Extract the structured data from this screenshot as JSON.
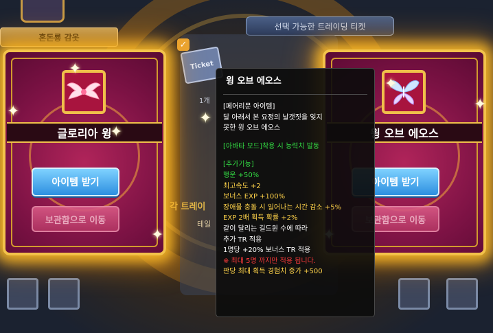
{
  "background": {
    "left_tab": "혼돈룡 감옷",
    "right_tab": "선택 가능한 트레이딩 티켓",
    "ticket_label": "Ticket",
    "ticket_qty": "1개",
    "info_heading": "각 트레이",
    "info_sub": "테일"
  },
  "cards": [
    {
      "name": "글로리아 윙",
      "get_button": "아이템 받기",
      "move_button": "보관함으로 이동",
      "icon": "gloria-wing-icon"
    },
    {
      "name": "윙 오브 에오스",
      "get_button": "아이템 받기",
      "move_button": "보관함으로 이동",
      "icon": "wing-of-eos-icon"
    }
  ],
  "tooltip": {
    "title": "윙 오브 에오스",
    "lines": [
      {
        "text": "[페어리문 아이템]",
        "color": "#ffffff"
      },
      {
        "text": "달 아래서 본 요정의 날갯짓을 잊지",
        "color": "#ffffff"
      },
      {
        "text": "못한 윙 오브 에오스",
        "color": "#ffffff"
      },
      {
        "text": "",
        "color": ""
      },
      {
        "text": "[아바타 모드]착용 시 능력치 발동",
        "color": "#33dd44"
      },
      {
        "text": "",
        "color": ""
      },
      {
        "text": "[추가기능]",
        "color": "#33dd44"
      },
      {
        "text": "행운 +50%",
        "color": "#33dd44"
      },
      {
        "text": "최고속도 +2",
        "color": "#ffd34a"
      },
      {
        "text": "보너스 EXP +100%",
        "color": "#ffd34a"
      },
      {
        "text": "장애물 충돌 시 일어나는 시간 감소 +5%",
        "color": "#ffd34a"
      },
      {
        "text": "EXP 2배 획득 확률 +2%",
        "color": "#ffd34a"
      },
      {
        "text": "같이 달리는 길드원 수에 따라",
        "color": "#ffffff"
      },
      {
        "text": "추가 TR 적용",
        "color": "#ffffff"
      },
      {
        "text": "1명당 +20% 보너스 TR 적용",
        "color": "#ffffff"
      },
      {
        "text": "※ 최대 5명 까지만 적용 됩니다.",
        "color": "#ff3b3b"
      },
      {
        "text": "판당 최대 획득 경험치 증가 +500",
        "color": "#ffd34a"
      }
    ]
  },
  "colors": {
    "card_glow": "#ffbe28",
    "card_body": "#7c1244",
    "button_blue": "#2d8fe0",
    "button_pink": "#b13462"
  }
}
